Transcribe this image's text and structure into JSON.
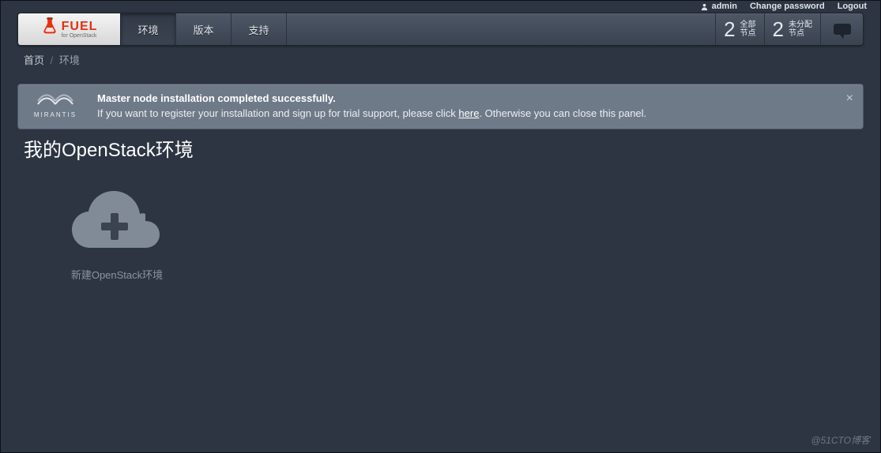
{
  "userbar": {
    "username": "admin",
    "change_password": "Change password",
    "logout": "Logout"
  },
  "logo": {
    "word": "FUEL",
    "subtitle": "for OpenStack"
  },
  "nav": {
    "environments": "环境",
    "versions": "版本",
    "support": "支持"
  },
  "stats": {
    "count1": "2",
    "label1": "全部\n节点",
    "count2": "2",
    "label2": "未分配\n节点"
  },
  "breadcrumb": {
    "home": "首页",
    "current": "环境"
  },
  "alert": {
    "brand": "MIRANTIS",
    "line1": "Master node installation completed successfully.",
    "line2a": "If you want to register your installation and sign up for trial support, please click ",
    "line2_link": "here",
    "line2b": ". Otherwise you can close this panel."
  },
  "page_title": "我的OpenStack环境",
  "tile": {
    "caption": "新建OpenStack环境"
  },
  "watermark": "@51CTO博客"
}
